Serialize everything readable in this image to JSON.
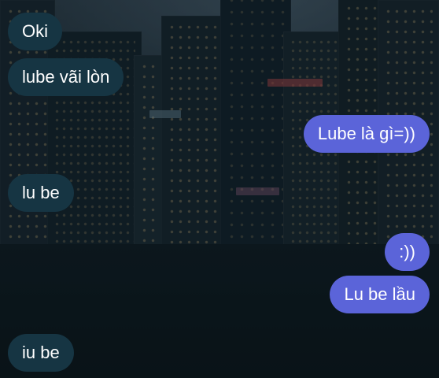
{
  "chat": {
    "messages": [
      {
        "sender": "received",
        "text": "Oki"
      },
      {
        "sender": "received",
        "text": "lube vãi lòn"
      },
      {
        "sender": "sent",
        "text": "Lube là gì=))"
      },
      {
        "sender": "received",
        "text": "lu be"
      },
      {
        "sender": "sent",
        "text": ":))"
      },
      {
        "sender": "sent",
        "text": "Lu be lầu"
      },
      {
        "sender": "received",
        "text": "iu be"
      }
    ]
  },
  "colors": {
    "received_bubble": "#163543",
    "sent_bubble": "#5b64d9",
    "text": "#ffffff"
  },
  "wallpaper": {
    "theme": "night-city-skyline"
  }
}
